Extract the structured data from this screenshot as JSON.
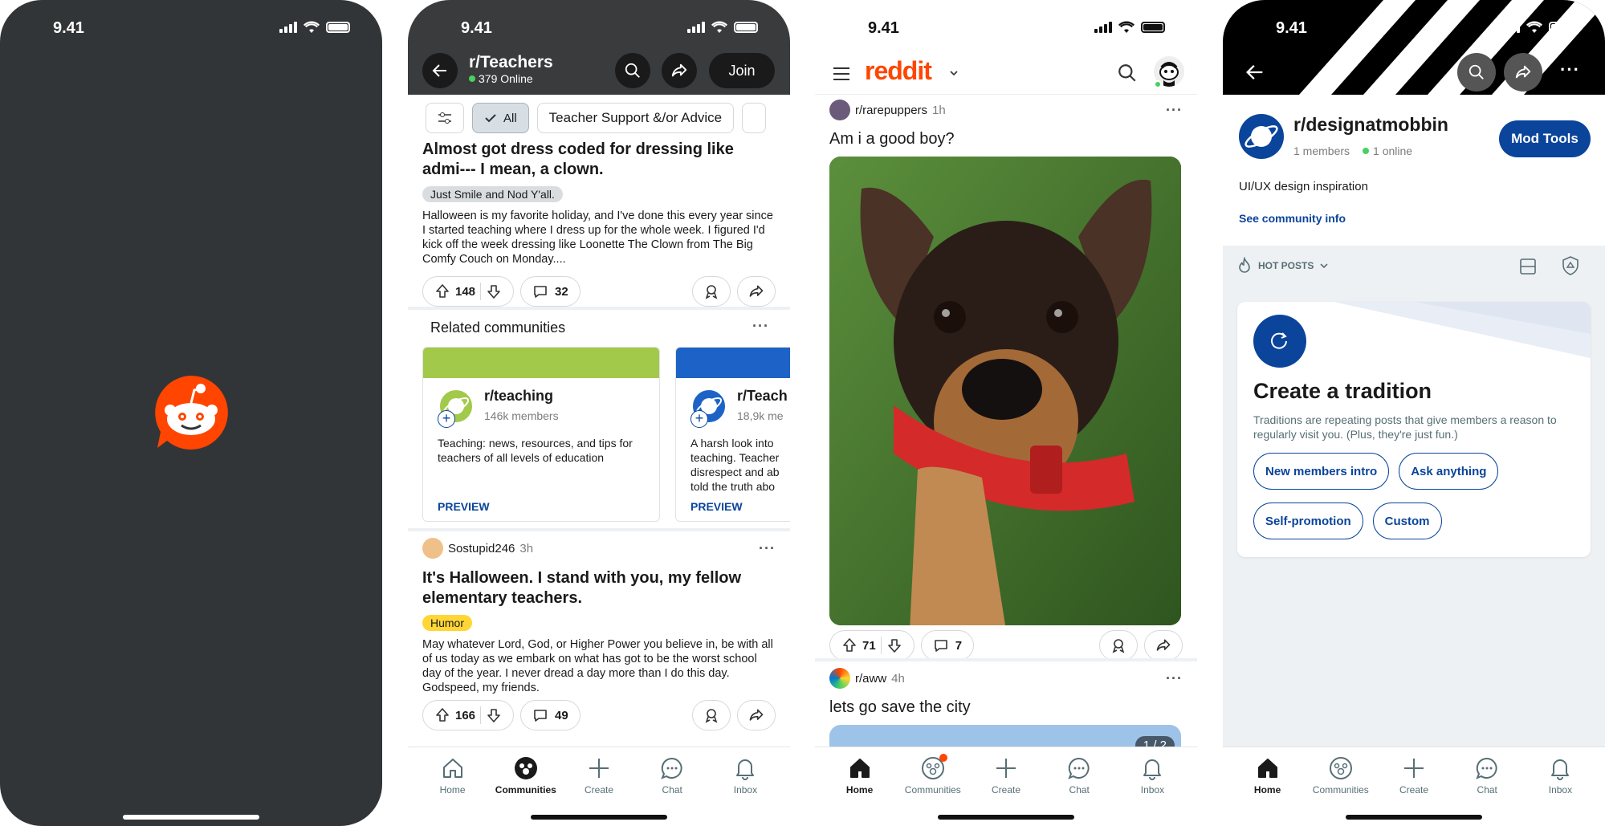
{
  "status": {
    "time": "9.41"
  },
  "screen2": {
    "header": {
      "title": "r/Teachers",
      "online": "379 Online",
      "join_label": "Join"
    },
    "filters": {
      "all_label": "All",
      "flair_label": "Teacher Support &/or Advice"
    },
    "post1": {
      "title": "Almost got dress coded for dressing like admi--- I mean, a clown.",
      "flair": "Just Smile and Nod Y'all.",
      "body": "Halloween is my favorite holiday, and I've done this every year since I started teaching where I dress up for the whole week. I figured I'd kick off the week dressing like Loonette The Clown from The Big Comfy Couch on Monday....",
      "votes": "148",
      "comments": "32"
    },
    "related": {
      "heading": "Related communities",
      "cards": [
        {
          "name": "r/teaching",
          "members": "146k members",
          "desc": "Teaching: news, resources, and tips for teachers of all levels of education",
          "preview": "PREVIEW",
          "color": "#a3c94a"
        },
        {
          "name": "r/Teach",
          "members": "18,9k me",
          "desc": "A harsh look into teaching. Teacher disrespect and ab told the truth abo",
          "preview": "PREVIEW",
          "color": "#1d63c7"
        }
      ]
    },
    "post2": {
      "user": "Sostupid246",
      "age": "3h",
      "title": "It's Halloween. I stand with you, my fellow elementary teachers.",
      "flair": "Humor",
      "body": "May whatever Lord, God, or Higher Power you believe in, be with all of us today as we embark on what has got to be the worst school day of the year. I never dread a day more than I do this day. Godspeed, my friends.",
      "votes": "166",
      "comments": "49"
    },
    "tabs": [
      {
        "label": "Home",
        "icon": "home-icon"
      },
      {
        "label": "Communities",
        "icon": "communities-icon"
      },
      {
        "label": "Create",
        "icon": "plus-icon"
      },
      {
        "label": "Chat",
        "icon": "chat-icon"
      },
      {
        "label": "Inbox",
        "icon": "bell-icon"
      }
    ]
  },
  "screen3": {
    "logo": "reddit",
    "post1": {
      "sub": "r/rarepuppers",
      "age": "1h",
      "title": "Am i a good boy?",
      "votes": "71",
      "comments": "7"
    },
    "post2": {
      "sub": "r/aww",
      "age": "4h",
      "title": "lets go save the city",
      "counter": "1 / 2"
    },
    "tabs": [
      {
        "label": "Home",
        "icon": "home-icon"
      },
      {
        "label": "Communities",
        "icon": "communities-icon"
      },
      {
        "label": "Create",
        "icon": "plus-icon"
      },
      {
        "label": "Chat",
        "icon": "chat-icon"
      },
      {
        "label": "Inbox",
        "icon": "bell-icon"
      }
    ]
  },
  "screen4": {
    "community": {
      "name": "r/designatmobbin",
      "members": "1 members",
      "online": "1 online",
      "mod_tools": "Mod Tools",
      "description": "UI/UX design inspiration",
      "info_link": "See community info"
    },
    "sort": {
      "label": "HOT POSTS"
    },
    "tradition": {
      "title": "Create a tradition",
      "body": "Traditions are repeating posts that give members a reason to regularly visit you. (Plus, they're just fun.)",
      "buttons": [
        "New members intro",
        "Ask anything",
        "Self-promotion",
        "Custom"
      ]
    },
    "tabs": [
      {
        "label": "Home",
        "icon": "home-icon"
      },
      {
        "label": "Communities",
        "icon": "communities-icon"
      },
      {
        "label": "Create",
        "icon": "plus-icon"
      },
      {
        "label": "Chat",
        "icon": "chat-icon"
      },
      {
        "label": "Inbox",
        "icon": "bell-icon"
      }
    ]
  },
  "colors": {
    "reddit_orange": "#ff4500",
    "brand_blue": "#0a449b",
    "online_green": "#46d160",
    "splash_bg": "#323537"
  }
}
